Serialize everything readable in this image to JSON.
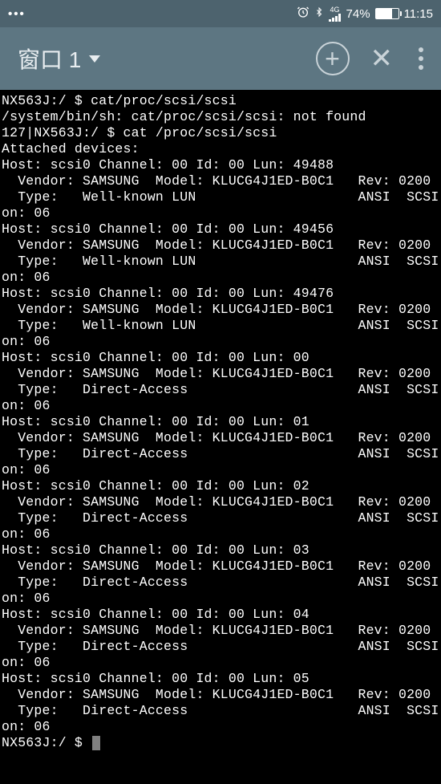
{
  "status_bar": {
    "dots": "•••",
    "alarm_icon": "⏰",
    "bluetooth_icon": "✱",
    "network_label": "4G",
    "battery_percent": "74%",
    "time": "11:15"
  },
  "app_bar": {
    "tab_label": "窗口 1",
    "add_label": "+",
    "close_label": "✕"
  },
  "terminal": {
    "prompt1_host": "NX563J:/ $ ",
    "prompt1_cmd": "cat/proc/scsi/scsi",
    "error_line": "/system/bin/sh: cat/proc/scsi/scsi: not found",
    "prompt2_host": "127|NX563J:/ $ ",
    "prompt2_cmd": "cat /proc/scsi/scsi",
    "attached": "Attached devices:",
    "devices": [
      {
        "host_line": "Host: scsi0 Channel: 00 Id: 00 Lun: 49488",
        "vendor_line": "  Vendor: SAMSUNG  Model: KLUCG4J1ED-B0C1   Rev: 0200",
        "type_line": "  Type:   Well-known LUN                    ANSI  SCSI revisi",
        "on_line": "on: 06"
      },
      {
        "host_line": "Host: scsi0 Channel: 00 Id: 00 Lun: 49456",
        "vendor_line": "  Vendor: SAMSUNG  Model: KLUCG4J1ED-B0C1   Rev: 0200",
        "type_line": "  Type:   Well-known LUN                    ANSI  SCSI revisi",
        "on_line": "on: 06"
      },
      {
        "host_line": "Host: scsi0 Channel: 00 Id: 00 Lun: 49476",
        "vendor_line": "  Vendor: SAMSUNG  Model: KLUCG4J1ED-B0C1   Rev: 0200",
        "type_line": "  Type:   Well-known LUN                    ANSI  SCSI revisi",
        "on_line": "on: 06"
      },
      {
        "host_line": "Host: scsi0 Channel: 00 Id: 00 Lun: 00",
        "vendor_line": "  Vendor: SAMSUNG  Model: KLUCG4J1ED-B0C1   Rev: 0200",
        "type_line": "  Type:   Direct-Access                     ANSI  SCSI revisi",
        "on_line": "on: 06"
      },
      {
        "host_line": "Host: scsi0 Channel: 00 Id: 00 Lun: 01",
        "vendor_line": "  Vendor: SAMSUNG  Model: KLUCG4J1ED-B0C1   Rev: 0200",
        "type_line": "  Type:   Direct-Access                     ANSI  SCSI revisi",
        "on_line": "on: 06"
      },
      {
        "host_line": "Host: scsi0 Channel: 00 Id: 00 Lun: 02",
        "vendor_line": "  Vendor: SAMSUNG  Model: KLUCG4J1ED-B0C1   Rev: 0200",
        "type_line": "  Type:   Direct-Access                     ANSI  SCSI revisi",
        "on_line": "on: 06"
      },
      {
        "host_line": "Host: scsi0 Channel: 00 Id: 00 Lun: 03",
        "vendor_line": "  Vendor: SAMSUNG  Model: KLUCG4J1ED-B0C1   Rev: 0200",
        "type_line": "  Type:   Direct-Access                     ANSI  SCSI revisi",
        "on_line": "on: 06"
      },
      {
        "host_line": "Host: scsi0 Channel: 00 Id: 00 Lun: 04",
        "vendor_line": "  Vendor: SAMSUNG  Model: KLUCG4J1ED-B0C1   Rev: 0200",
        "type_line": "  Type:   Direct-Access                     ANSI  SCSI revisi",
        "on_line": "on: 06"
      },
      {
        "host_line": "Host: scsi0 Channel: 00 Id: 00 Lun: 05",
        "vendor_line": "  Vendor: SAMSUNG  Model: KLUCG4J1ED-B0C1   Rev: 0200",
        "type_line": "  Type:   Direct-Access                     ANSI  SCSI revisi",
        "on_line": "on: 06"
      }
    ],
    "final_prompt": "NX563J:/ $ "
  }
}
